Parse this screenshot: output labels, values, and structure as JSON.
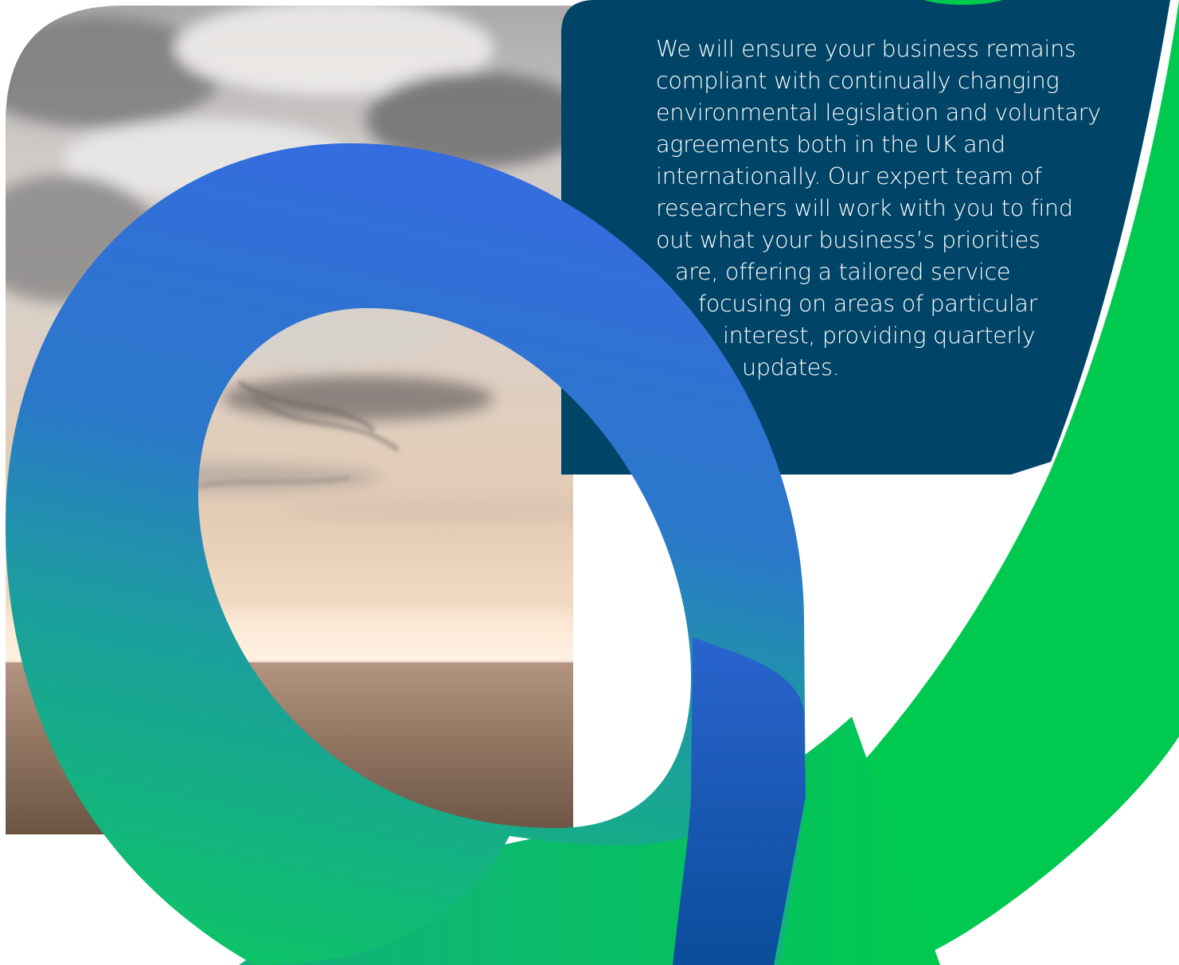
{
  "colors": {
    "panel": "#004467",
    "green": "#00C94F",
    "blue_top": "#356CE0",
    "blue_bottom": "#0A4D9A",
    "teal": "#1C9CA0",
    "text": "#FFFFFF"
  },
  "background_image": "sky-over-desert-landscape",
  "body_lines": [
    "We will ensure your business remains",
    "compliant with continually changing",
    "environmental legislation and voluntary",
    "agreements both in the UK and",
    "internationally. Our expert team of",
    "researchers will work with you to find",
    "out what your business’s priorities",
    "are, offering a tailored service",
    "focusing on areas of particular",
    "interest, providing quarterly",
    "updates."
  ]
}
